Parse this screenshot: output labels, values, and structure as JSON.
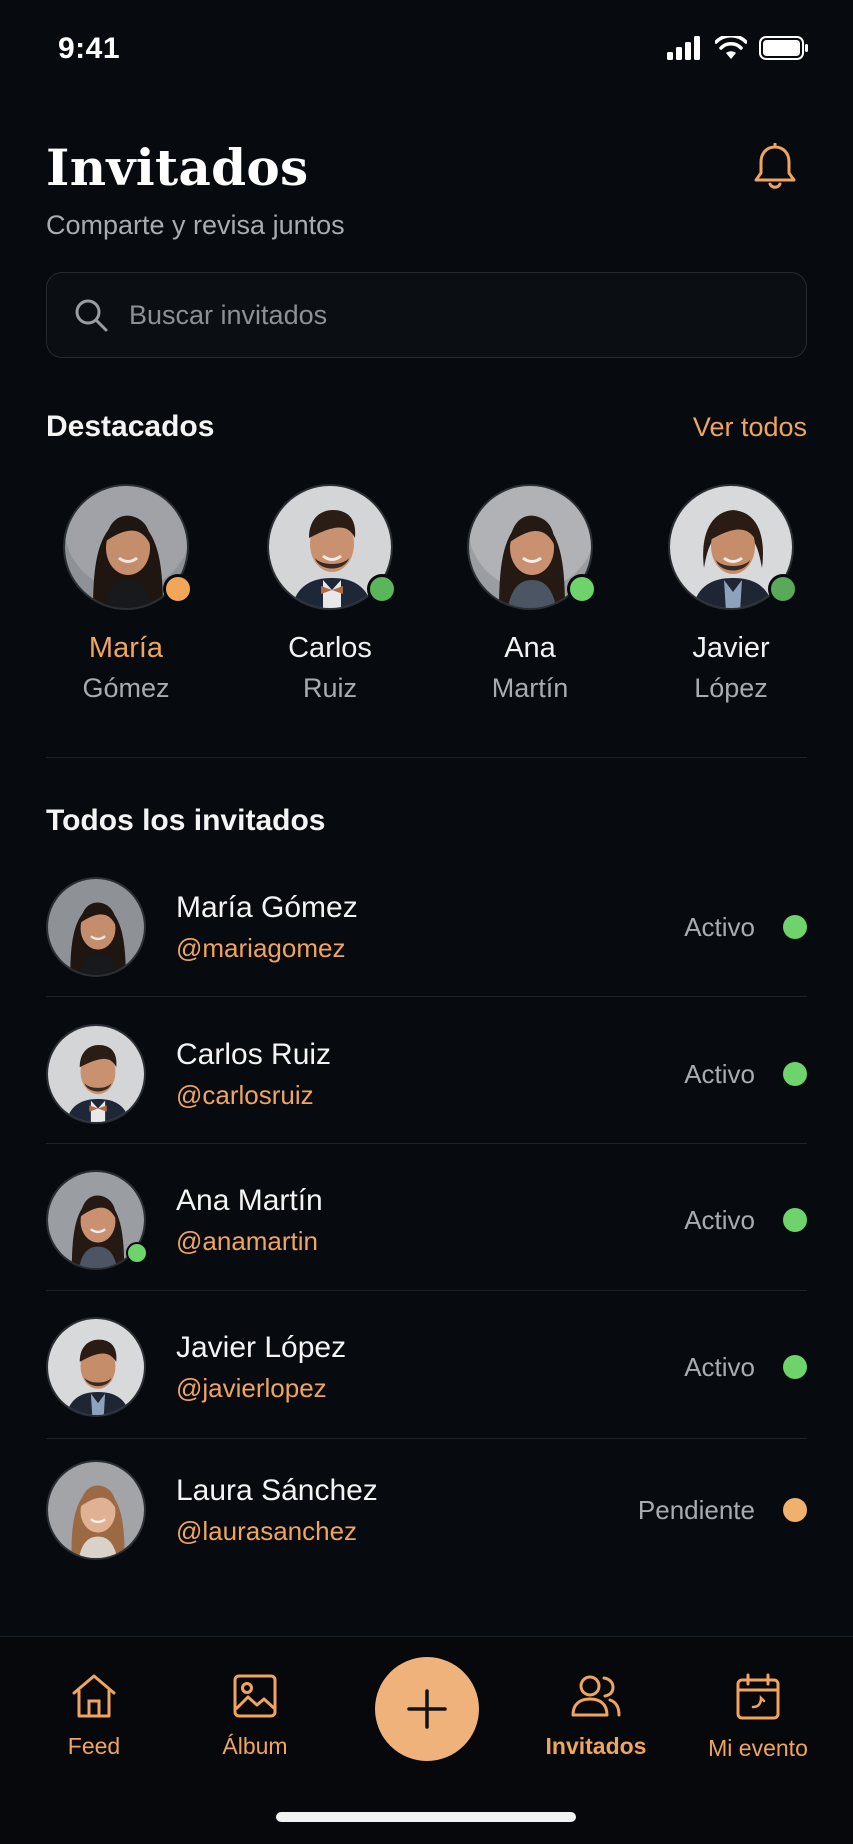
{
  "status_bar": {
    "time": "9:41"
  },
  "header": {
    "title": "Invitados",
    "subtitle": "Comparte y revisa juntos"
  },
  "search": {
    "placeholder": "Buscar invitados",
    "value": ""
  },
  "featured": {
    "title": "Destacados",
    "see_all": "Ver todos",
    "items": [
      {
        "first": "María",
        "last": "Gómez",
        "status_color": "#f2a65a",
        "highlight": true
      },
      {
        "first": "Carlos",
        "last": "Ruiz",
        "status_color": "#5bb55b",
        "highlight": false
      },
      {
        "first": "Ana",
        "last": "Martín",
        "status_color": "#6dd36a",
        "highlight": false
      },
      {
        "first": "Javier",
        "last": "López",
        "status_color": "#5aa95a",
        "highlight": false
      }
    ]
  },
  "guests": {
    "title": "Todos los invitados",
    "rows": [
      {
        "name": "María Gómez",
        "handle": "@mariagomez",
        "status": "Activo",
        "status_color": "#6dd36a"
      },
      {
        "name": "Carlos Ruiz",
        "handle": "@carlosruiz",
        "status": "Activo",
        "status_color": "#6dd36a"
      },
      {
        "name": "Ana Martín",
        "handle": "@anamartin",
        "status": "Activo",
        "status_color": "#6dd36a"
      },
      {
        "name": "Javier López",
        "handle": "@javierlopez",
        "status": "Activo",
        "status_color": "#6dd36a"
      },
      {
        "name": "Laura Sánchez",
        "handle": "@laurasanchez",
        "status": "Pendiente",
        "status_color": "#f0b06e"
      }
    ]
  },
  "nav": {
    "items": [
      {
        "label": "Feed",
        "icon": "home-icon"
      },
      {
        "label": "Álbum",
        "icon": "image-icon"
      },
      {
        "label": "Invitados",
        "icon": "users-icon",
        "active": true
      },
      {
        "label": "Mi evento",
        "icon": "calendar-icon"
      }
    ],
    "fab_icon": "plus-icon"
  },
  "colors": {
    "accent": "#efa55f",
    "background": "#070a0e",
    "active": "#6dd36a",
    "pending": "#f0b06e"
  }
}
